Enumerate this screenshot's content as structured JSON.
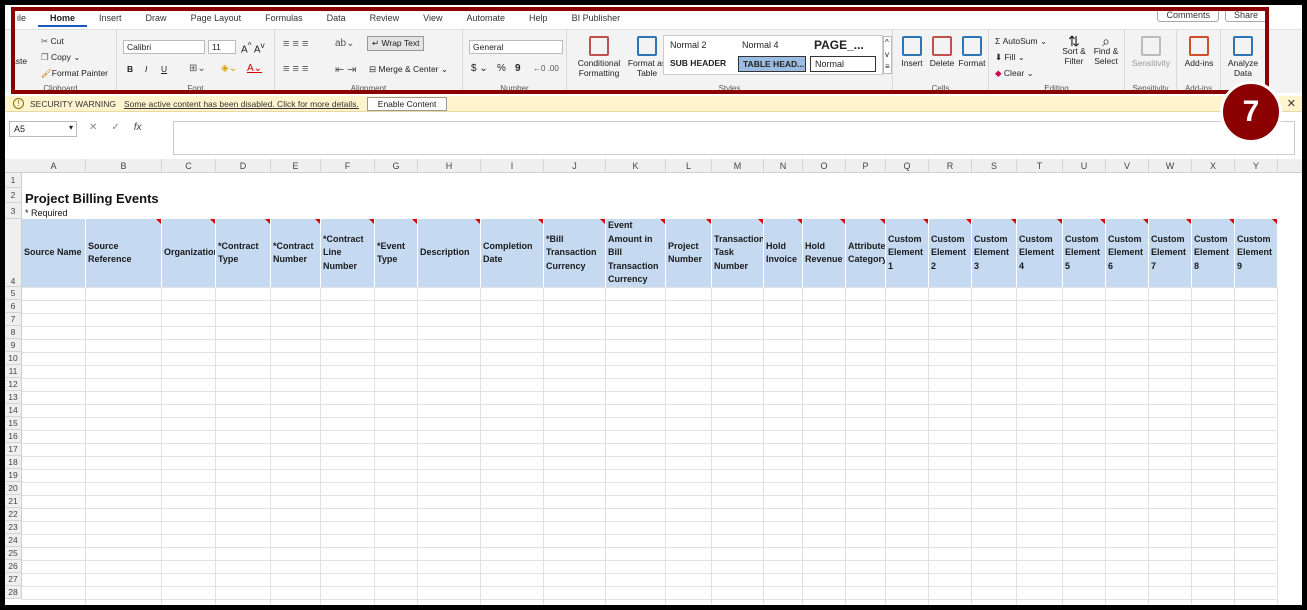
{
  "tabs": [
    "ile",
    "Home",
    "Insert",
    "Draw",
    "Page Layout",
    "Formulas",
    "Data",
    "Review",
    "View",
    "Automate",
    "Help",
    "BI Publisher"
  ],
  "tabs_active": "Home",
  "top_right": {
    "comments": "Comments",
    "share": "Share"
  },
  "ribbon": {
    "clipboard": {
      "paste": "aste",
      "cut": "Cut",
      "copy": "Copy",
      "format_painter": "Format Painter",
      "label": "Clipboard"
    },
    "font": {
      "name": "Calibri",
      "size": "11",
      "label": "Font",
      "bold": "B",
      "italic": "I",
      "underline": "U"
    },
    "alignment": {
      "wrap": "Wrap Text",
      "merge": "Merge & Center",
      "label": "Alignment"
    },
    "number": {
      "format": "General",
      "label": "Number",
      "currency": "$",
      "percent": "%",
      "comma": "9"
    },
    "styles": {
      "conditional": "Conditional Formatting",
      "format_table": "Format as Table",
      "normal2": "Normal 2",
      "normal4": "Normal 4",
      "page": "PAGE_...",
      "subheader": "SUB HEADER",
      "tablehead": "TABLE HEAD...",
      "normal": "Normal",
      "label": "Styles"
    },
    "cells": {
      "insert": "Insert",
      "delete": "Delete",
      "format": "Format",
      "label": "Cells"
    },
    "editing": {
      "autosum": "AutoSum",
      "fill": "Fill",
      "clear": "Clear",
      "sort": "Sort & Filter",
      "find": "Find & Select",
      "label": "Editing"
    },
    "sensitivity": {
      "btn": "Sensitivity",
      "label": "Sensitivity"
    },
    "addins": {
      "btn": "Add-ins",
      "label": "Add-ins"
    },
    "analyze": {
      "btn": "Analyze Data"
    }
  },
  "security": {
    "title": "SECURITY WARNING",
    "message": "Some active content has been disabled. Click for more details.",
    "button": "Enable Content"
  },
  "namebox": "A5",
  "step_badge": "7",
  "sheet": {
    "title": "Project Billing Events",
    "required": "* Required",
    "columns": [
      "A",
      "B",
      "C",
      "D",
      "E",
      "F",
      "G",
      "H",
      "I",
      "J",
      "K",
      "L",
      "M",
      "N",
      "O",
      "P",
      "Q",
      "R",
      "S",
      "T",
      "U",
      "V",
      "W",
      "X",
      "Y"
    ],
    "headers": [
      "Source Name",
      "Source Reference",
      "Organization",
      "*Contract Type",
      "*Contract Number",
      "*Contract Line Number",
      "*Event Type",
      "Description",
      "Completion Date",
      "*Bill Transaction Currency",
      "Event Amount in Bill Transaction Currency",
      "Project Number",
      "Transaction Task Number",
      "Hold Invoice",
      "Hold Revenue",
      "Attribute Category",
      "Custom Element 1",
      "Custom Element 2",
      "Custom Element 3",
      "Custom Element 4",
      "Custom Element 5",
      "Custom Element 6",
      "Custom Element 7",
      "Custom Element 8",
      "Custom Element 9"
    ],
    "rows": [
      "1",
      "2",
      "3",
      "4",
      "5",
      "6",
      "7",
      "8",
      "9",
      "10",
      "11",
      "12",
      "13",
      "14",
      "15",
      "16",
      "17",
      "18",
      "19",
      "20",
      "21",
      "22",
      "23",
      "24",
      "25",
      "26",
      "27",
      "28"
    ]
  }
}
